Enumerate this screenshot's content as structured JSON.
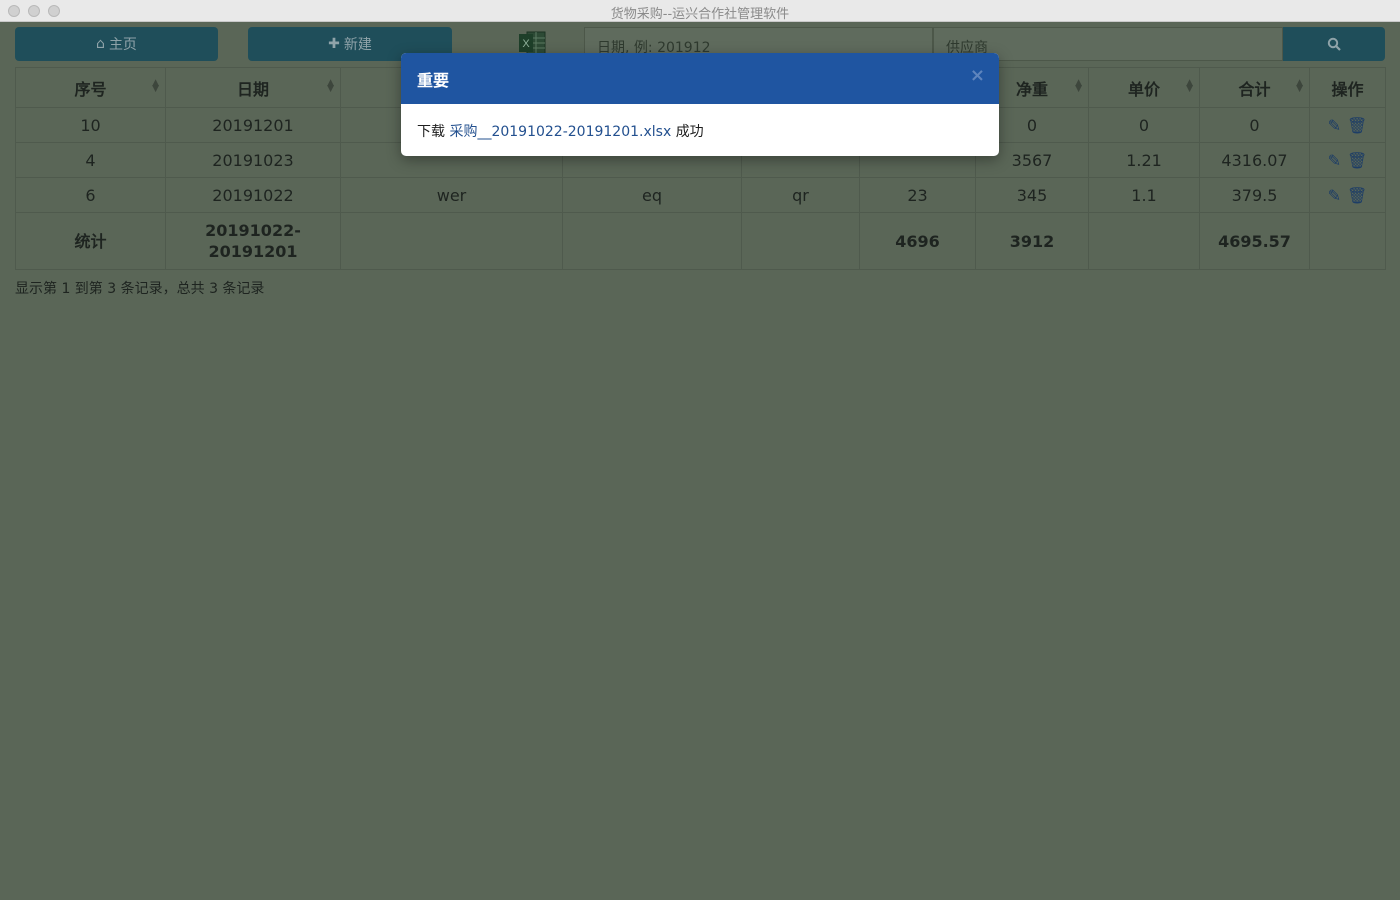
{
  "window": {
    "title": "货物采购--运兴合作社管理软件"
  },
  "toolbar": {
    "home_label": "主页",
    "home_icon": "home-icon",
    "new_label": "新建",
    "new_icon": "plus-icon",
    "excel_icon": "excel-icon",
    "date_placeholder": "日期, 例: 201912",
    "supplier_placeholder": "供应商",
    "search_icon": "search-icon"
  },
  "table": {
    "headers": [
      "序号",
      "日期",
      "",
      "",
      "",
      "",
      "净重",
      "单价",
      "合计",
      "操作"
    ],
    "rows": [
      {
        "id": "10",
        "date": "20191201",
        "c3": "",
        "c4": "",
        "c5": "",
        "c6": "",
        "net": "0",
        "price": "0",
        "total": "0"
      },
      {
        "id": "4",
        "date": "20191023",
        "c3": "",
        "c4": "",
        "c5": "",
        "c6": "",
        "net": "3567",
        "price": "1.21",
        "total": "4316.07"
      },
      {
        "id": "6",
        "date": "20191022",
        "c3": "wer",
        "c4": "eq",
        "c5": "qr",
        "c6": "23",
        "net": "345",
        "price": "1.1",
        "total": "379.5"
      }
    ],
    "summary": {
      "label": "统计",
      "date_from": "20191022-",
      "date_to": "20191201",
      "c6": "4696",
      "net": "3912",
      "total": "4695.57"
    },
    "action_icons": [
      "pencil-icon",
      "trash-icon"
    ]
  },
  "pager": {
    "text": "显示第 1 到第 3 条记录，总共 3 条记录"
  },
  "modal": {
    "title": "重要",
    "close_symbol": "×",
    "prefix": "下载",
    "filename": "采购__20191022-20191201.xlsx",
    "suffix": "成功"
  },
  "colors": {
    "overlay_bg": "#5a6657",
    "modal_header": "#1f55a1",
    "button_bg": "#1f4e5a",
    "link": "#23508f"
  }
}
